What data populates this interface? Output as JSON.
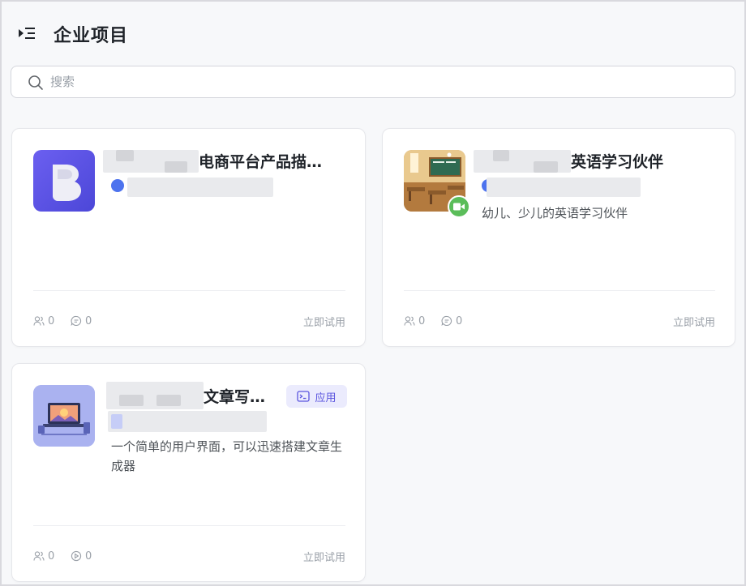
{
  "header": {
    "title": "企业项目"
  },
  "search": {
    "placeholder": "搜索",
    "value": ""
  },
  "cards": [
    {
      "name_visible": "电商平台产品描…",
      "description": "",
      "users": "0",
      "comments": "0",
      "action": "立即试用"
    },
    {
      "name_visible": "英语学习伙伴",
      "description": "幼儿、少儿的英语学习伙伴",
      "users": "0",
      "comments": "0",
      "action": "立即试用"
    },
    {
      "name_visible": "文章写…",
      "badge": "应用",
      "description": "一个简单的用户界面，可以迅速搭建文章生成器",
      "users": "0",
      "runs": "0",
      "action": "立即试用"
    }
  ],
  "colors": {
    "accent": "#5b55df",
    "badge_bg": "#ebebfd",
    "video_badge": "#5bbd5a",
    "author_dot": "#4d73ee"
  }
}
